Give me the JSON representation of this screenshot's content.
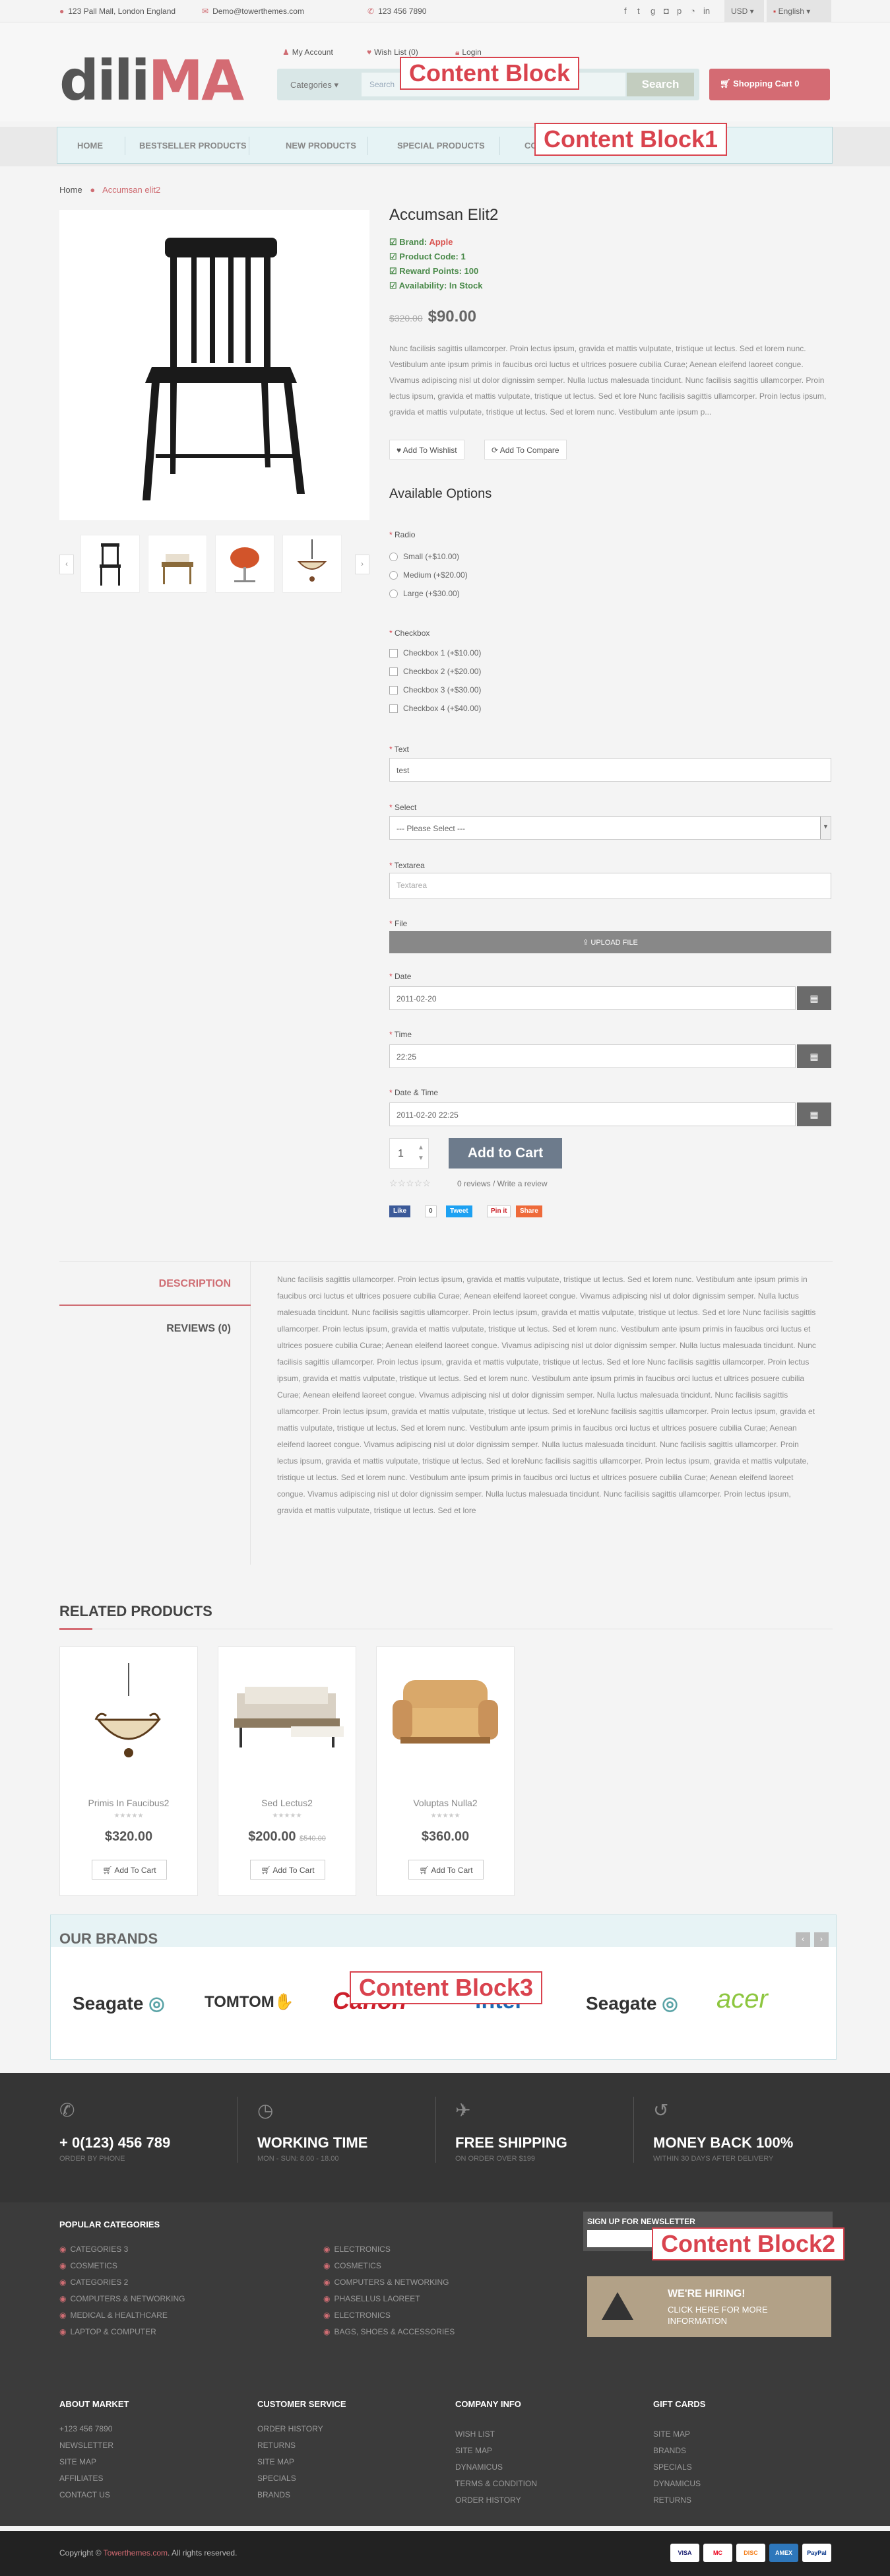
{
  "topbar": {
    "address": "123 Pall Mall, London England",
    "email": "Demo@towerthemes.com",
    "phone": "123 456 7890",
    "currency": "USD",
    "language": "English"
  },
  "header": {
    "logo_a": "dili",
    "logo_b": "MA",
    "my_account": "My Account",
    "wishlist": "Wish List (0)",
    "login": "Login",
    "categories": "Categories",
    "search_placeholder": "Search",
    "search_button": "Search",
    "cart": "Shopping Cart 0"
  },
  "nav": {
    "items": [
      "HOME",
      "BESTSELLER PRODUCTS",
      "NEW PRODUCTS",
      "SPECIAL PRODUCTS",
      "CO"
    ]
  },
  "overlays": {
    "b0": "Content Block",
    "b1": "Content Block1",
    "b2": "Content Block2",
    "b3": "Content Block3"
  },
  "breadcrumb": {
    "home": "Home",
    "current": "Accumsan elit2"
  },
  "product": {
    "title": "Accumsan Elit2",
    "brand_label": "Brand:",
    "brand": "Apple",
    "code_label": "Product Code:",
    "code": "1",
    "points_label": "Reward Points:",
    "points": "100",
    "avail_label": "Availability:",
    "avail": "In Stock",
    "old_price": "$320.00",
    "price": "$90.00",
    "desc": "Nunc facilisis sagittis ullamcorper. Proin lectus ipsum, gravida et mattis vulputate, tristique ut lectus. Sed et lorem nunc. Vestibulum ante ipsum primis in faucibus orci luctus et ultrices posuere cubilia Curae; Aenean eleifend laoreet congue. Vivamus adipiscing nisl ut dolor dignissim semper. Nulla luctus malesuada tincidunt. Nunc facilisis sagittis ullamcorper. Proin lectus ipsum, gravida et mattis vulputate, tristique ut lectus. Sed et lore Nunc facilisis sagittis ullamcorper. Proin lectus ipsum, gravida et mattis vulputate, tristique ut lectus. Sed et lorem nunc. Vestibulum ante ipsum p...",
    "wishlist_btn": "Add To Wishlist",
    "compare_btn": "Add To Compare",
    "options_heading": "Available Options",
    "radio_label": "Radio",
    "radio": [
      "Small (+$10.00)",
      "Medium (+$20.00)",
      "Large (+$30.00)"
    ],
    "checkbox_label": "Checkbox",
    "checkbox": [
      "Checkbox 1 (+$10.00)",
      "Checkbox 2 (+$20.00)",
      "Checkbox 3 (+$30.00)",
      "Checkbox 4 (+$40.00)"
    ],
    "text_label": "Text",
    "text_value": "test",
    "select_label": "Select",
    "select_value": "--- Please Select ---",
    "textarea_label": "Textarea",
    "textarea_placeholder": "Textarea",
    "file_label": "File",
    "file_btn": "UPLOAD FILE",
    "date_label": "Date",
    "date_value": "2011-02-20",
    "time_label": "Time",
    "time_value": "22:25",
    "datetime_label": "Date & Time",
    "datetime_value": "2011-02-20 22:25",
    "qty": "1",
    "add_to_cart": "Add to Cart",
    "reviews": "0 reviews / Write a review",
    "share": [
      "Like",
      "0",
      "Tweet",
      "Pin it",
      "Share"
    ]
  },
  "tabs": {
    "description": "DESCRIPTION",
    "reviews": "REVIEWS (0)",
    "text": "Nunc facilisis sagittis ullamcorper. Proin lectus ipsum, gravida et mattis vulputate, tristique ut lectus. Sed et lorem nunc. Vestibulum ante ipsum primis in faucibus orci luctus et ultrices posuere cubilia Curae; Aenean eleifend laoreet congue. Vivamus adipiscing nisl ut dolor dignissim semper. Nulla luctus malesuada tincidunt. Nunc facilisis sagittis ullamcorper. Proin lectus ipsum, gravida et mattis vulputate, tristique ut lectus. Sed et lore Nunc facilisis sagittis ullamcorper. Proin lectus ipsum, gravida et mattis vulputate, tristique ut lectus. Sed et lorem nunc. Vestibulum ante ipsum primis in faucibus orci luctus et ultrices posuere cubilia Curae; Aenean eleifend laoreet congue. Vivamus adipiscing nisl ut dolor dignissim semper. Nulla luctus malesuada tincidunt. Nunc facilisis sagittis ullamcorper. Proin lectus ipsum, gravida et mattis vulputate, tristique ut lectus. Sed et lore Nunc facilisis sagittis ullamcorper. Proin lectus ipsum, gravida et mattis vulputate, tristique ut lectus. Sed et lorem nunc. Vestibulum ante ipsum primis in faucibus orci luctus et ultrices posuere cubilia Curae; Aenean eleifend laoreet congue. Vivamus adipiscing nisl ut dolor dignissim semper. Nulla luctus malesuada tincidunt. Nunc facilisis sagittis ullamcorper. Proin lectus ipsum, gravida et mattis vulputate, tristique ut lectus. Sed et loreNunc facilisis sagittis ullamcorper. Proin lectus ipsum, gravida et mattis vulputate, tristique ut lectus. Sed et lorem nunc. Vestibulum ante ipsum primis in faucibus orci luctus et ultrices posuere cubilia Curae; Aenean eleifend laoreet congue. Vivamus adipiscing nisl ut dolor dignissim semper. Nulla luctus malesuada tincidunt. Nunc facilisis sagittis ullamcorper. Proin lectus ipsum, gravida et mattis vulputate, tristique ut lectus. Sed et loreNunc facilisis sagittis ullamcorper. Proin lectus ipsum, gravida et mattis vulputate, tristique ut lectus. Sed et lorem nunc. Vestibulum ante ipsum primis in faucibus orci luctus et ultrices posuere cubilia Curae; Aenean eleifend laoreet congue. Vivamus adipiscing nisl ut dolor dignissim semper. Nulla luctus malesuada tincidunt. Nunc facilisis sagittis ullamcorper. Proin lectus ipsum, gravida et mattis vulputate, tristique ut lectus. Sed et lore"
  },
  "related": {
    "heading": "RELATED PRODUCTS",
    "add_btn": "Add To Cart",
    "items": [
      {
        "name": "Primis In Faucibus2",
        "price": "$320.00",
        "old": ""
      },
      {
        "name": "Sed Lectus2",
        "price": "$200.00",
        "old": "$540.00"
      },
      {
        "name": "Voluptas Nulla2",
        "price": "$360.00",
        "old": ""
      }
    ]
  },
  "brands": {
    "heading": "OUR BRANDS",
    "items": [
      "Seagate",
      "TOMTOM",
      "Canon",
      "intel",
      "Seagate",
      "acer"
    ]
  },
  "features": [
    {
      "title": "+ 0(123) 456 789",
      "sub": "ORDER BY PHONE"
    },
    {
      "title": "WORKING TIME",
      "sub": "MON - SUN: 8.00 - 18.00"
    },
    {
      "title": "FREE SHIPPING",
      "sub": "ON ORDER OVER $199"
    },
    {
      "title": "MONEY BACK 100%",
      "sub": "WITHIN 30 DAYS AFTER DELIVERY"
    }
  ],
  "popular": {
    "heading": "POPULAR CATEGORIES",
    "col1": [
      "CATEGORIES 3",
      "COSMETICS",
      "CATEGORIES 2",
      "COMPUTERS & NETWORKING",
      "MEDICAL & HEALTHCARE",
      "LAPTOP & COMPUTER"
    ],
    "col2": [
      "ELECTRONICS",
      "COSMETICS",
      "COMPUTERS & NETWORKING",
      "PHASELLUS LAOREET",
      "ELECTRONICS",
      "BAGS, SHOES & ACCESSORIES"
    ]
  },
  "newsletter": {
    "label": "SIGN UP FOR NEWSLETTER",
    "hire_title": "WE'RE HIRING!",
    "hire_sub": "CLICK HERE FOR MORE INFORMATION"
  },
  "footer_cols": [
    {
      "heading": "ABOUT MARKET",
      "links": [
        "+123 456 7890",
        "NEWSLETTER",
        "SITE MAP",
        "AFFILIATES",
        "CONTACT US"
      ]
    },
    {
      "heading": "CUSTOMER SERVICE",
      "links": [
        "ORDER HISTORY",
        "RETURNS",
        "SITE MAP",
        "SPECIALS",
        "BRANDS"
      ]
    },
    {
      "heading": "COMPANY INFO",
      "links": [
        "WISH LIST",
        "SITE MAP",
        "DYNAMICUS",
        "TERMS & CONDITION",
        "ORDER HISTORY"
      ]
    },
    {
      "heading": "GIFT CARDS",
      "links": [
        "SITE MAP",
        "BRANDS",
        "SPECIALS",
        "DYNAMICUS",
        "RETURNS"
      ]
    }
  ],
  "copyright": {
    "prefix": "Copyright ©",
    "brand": "Towerthemes.com",
    "suffix": ". All rights reserved."
  },
  "payments": [
    "VISA",
    "MC",
    "DISC",
    "AMEX",
    "PayPal"
  ],
  "colors": {
    "accent": "#d46b73",
    "nav_bg": "#e6f3f5",
    "footer": "#3b3b3b"
  }
}
